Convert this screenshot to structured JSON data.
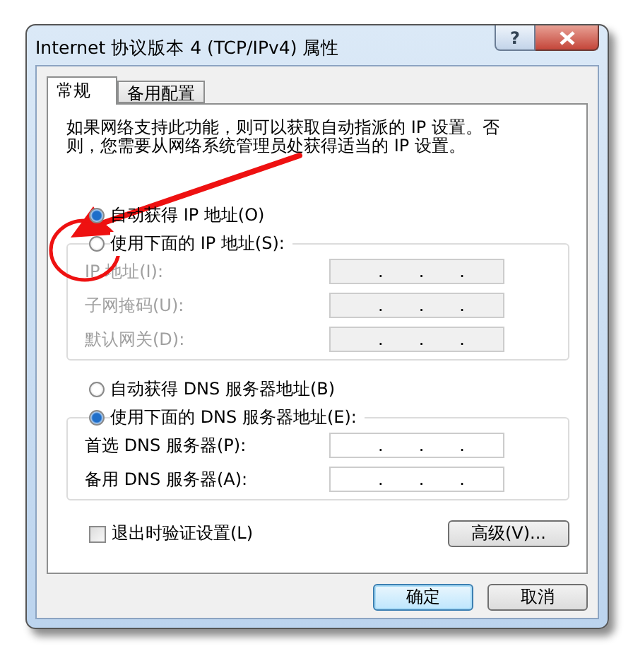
{
  "window": {
    "title": "Internet 协议版本 4 (TCP/IPv4) 属性",
    "help": "?"
  },
  "tabs": [
    {
      "label": "常规",
      "selected": true
    },
    {
      "label": "备用配置",
      "selected": false
    }
  ],
  "description": "如果网络支持此功能，则可以获取自动指派的 IP 设置。否则，您需要从网络系统管理员处获得适当的 IP 设置。",
  "sections": [
    {
      "options": [
        {
          "label": "自动获得 IP 地址(O)",
          "selected": true
        },
        {
          "label": "使用下面的 IP 地址(S):",
          "selected": false
        }
      ],
      "fields": [
        {
          "label": "IP 地址(I):",
          "disabled": true,
          "separators": [
            ".",
            ".",
            "."
          ]
        },
        {
          "label": "子网掩码(U):",
          "disabled": true,
          "separators": [
            ".",
            ".",
            "."
          ]
        },
        {
          "label": "默认网关(D):",
          "disabled": true,
          "separators": [
            ".",
            ".",
            "."
          ]
        }
      ]
    },
    {
      "options": [
        {
          "label": "自动获得 DNS 服务器地址(B)",
          "selected": false
        },
        {
          "label": "使用下面的 DNS 服务器地址(E):",
          "selected": true
        }
      ],
      "fields": [
        {
          "label": "首选 DNS 服务器(P):",
          "disabled": false,
          "separators": [
            ".",
            ".",
            "."
          ]
        },
        {
          "label": "备用 DNS 服务器(A):",
          "disabled": false,
          "separators": [
            ".",
            ".",
            "."
          ]
        }
      ]
    }
  ],
  "validate_on_exit": {
    "label": "退出时验证设置(L)",
    "checked": false
  },
  "advanced_button": "高级(V)...",
  "buttons": [
    {
      "label": "确定",
      "default": true
    },
    {
      "label": "取消",
      "default": false
    }
  ]
}
